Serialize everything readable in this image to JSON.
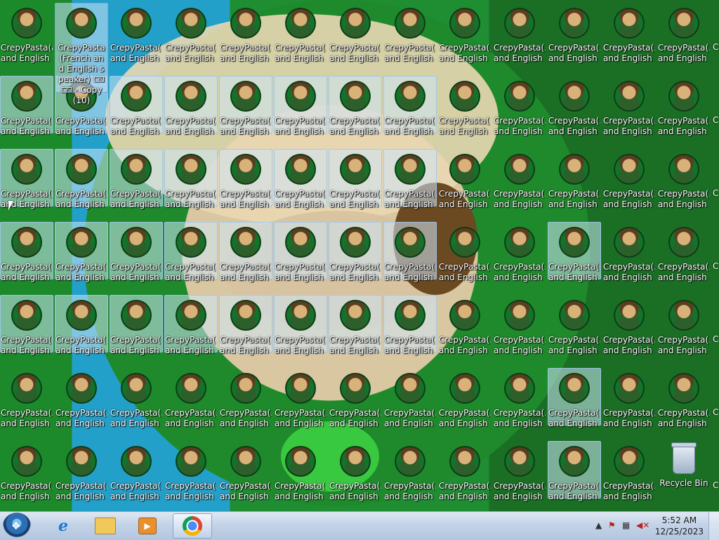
{
  "desktop": {
    "truncated_label_line1": "CrepyPasta(...",
    "truncated_label_line2": "and English ...",
    "focused_label": "CrepyPasta(French and English speaker) 🀴🀴 - Copy (10)",
    "first_label_line1": "CrepyPasta(a...",
    "recycle_bin_label": "Recycle Bin",
    "edge_fragment": "C"
  },
  "taskbar": {
    "start_icon": "windows-logo",
    "pinned": [
      {
        "name": "internet-explorer",
        "icon": "ie-icon"
      },
      {
        "name": "windows-explorer",
        "icon": "folder-icon"
      },
      {
        "name": "media-player",
        "icon": "media-icon"
      },
      {
        "name": "google-chrome",
        "icon": "chrome-icon",
        "active": true
      }
    ],
    "tray": {
      "time": "5:52 AM",
      "date": "12/25/2023"
    }
  },
  "colors": {
    "selection": "#cde6f7",
    "taskbar_top": "#dfe8f4",
    "taskbar_bottom": "#b3c6df"
  }
}
